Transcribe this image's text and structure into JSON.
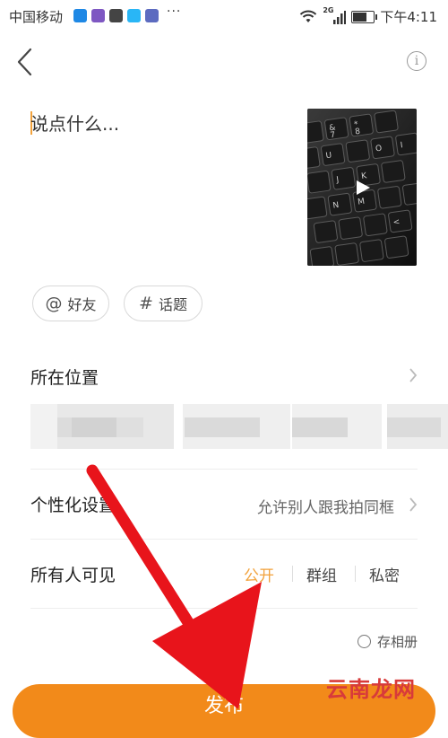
{
  "status_bar": {
    "carrier": "中国移动",
    "more": "···",
    "network": "2G",
    "time": "下午4:11",
    "battery_level": 0.6,
    "app_colors": [
      "#1e88e5",
      "#7e57c2",
      "#444444",
      "#29b6f6",
      "#5c6bc0"
    ]
  },
  "header": {
    "back_icon": "chevron-left-icon",
    "info_icon": "info-icon",
    "info_glyph": "i"
  },
  "compose": {
    "placeholder": "说点什么..."
  },
  "media": {
    "play_icon": "play-icon",
    "keyboard_keys": [
      "&",
      "*",
      "7",
      "8",
      "U",
      "I",
      "J",
      "K",
      "M",
      "N",
      "<",
      "O"
    ]
  },
  "chips": {
    "friends": {
      "icon": "@",
      "label": "好友"
    },
    "topic": {
      "icon": "#",
      "label": "话题"
    }
  },
  "location": {
    "label": "所在位置"
  },
  "personalize": {
    "label": "个性化设置",
    "value": "允许别人跟我拍同框"
  },
  "visibility": {
    "label": "所有人可见",
    "options": [
      "公开",
      "群组",
      "私密"
    ],
    "selected": "公开",
    "accent": "#f2a23c"
  },
  "album": {
    "label": "存相册"
  },
  "publish": {
    "label": "发布",
    "color": "#f28a1a"
  },
  "overlay": {
    "arrow_color": "#e8141b",
    "watermark": "云南龙网"
  }
}
